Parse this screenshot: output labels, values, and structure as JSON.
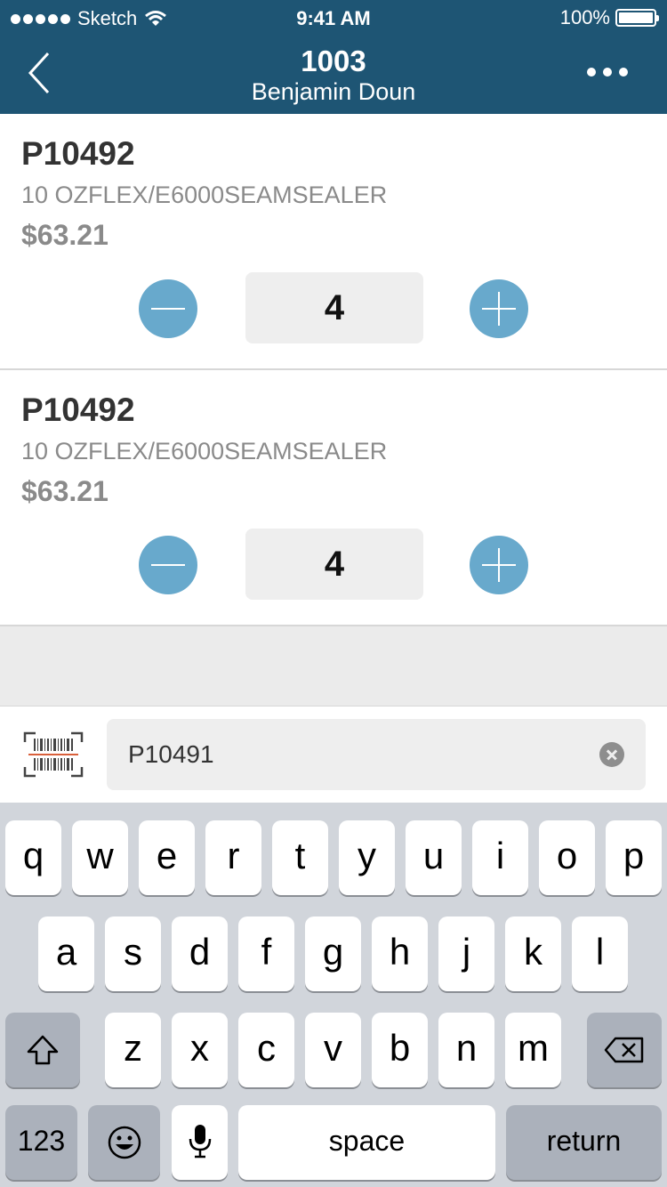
{
  "status_bar": {
    "carrier": "Sketch",
    "time": "9:41 AM",
    "battery": "100%"
  },
  "nav": {
    "title": "1003",
    "subtitle": "Benjamin Doun"
  },
  "items": [
    {
      "code": "P10492",
      "description": "10 OZFLEX/E6000SEAMSEALER",
      "price": "$63.21",
      "quantity": "4"
    },
    {
      "code": "P10492",
      "description": "10 OZFLEX/E6000SEAMSEALER",
      "price": "$63.21",
      "quantity": "4"
    }
  ],
  "search": {
    "value": "P10491"
  },
  "keyboard": {
    "row1": [
      "q",
      "w",
      "e",
      "r",
      "t",
      "y",
      "u",
      "i",
      "o",
      "p"
    ],
    "row2": [
      "a",
      "s",
      "d",
      "f",
      "g",
      "h",
      "j",
      "k",
      "l"
    ],
    "row3": [
      "z",
      "x",
      "c",
      "v",
      "b",
      "n",
      "m"
    ],
    "numbers_label": "123",
    "space_label": "space",
    "return_label": "return"
  },
  "colors": {
    "header": "#1e5574",
    "stepper": "#68a9cc",
    "keyboard": "#d1d5db"
  }
}
